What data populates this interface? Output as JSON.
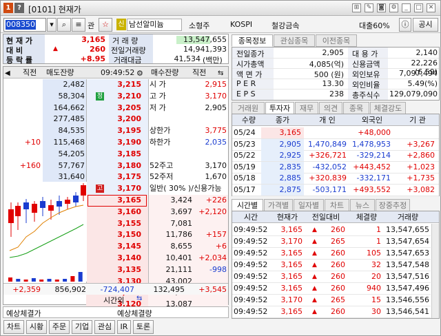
{
  "title": {
    "num1": "1",
    "num2": "?",
    "text": "[0101] 현재가"
  },
  "toolbar": {
    "code": "008350",
    "kwan": "관",
    "sin": "신",
    "name": "남선알미늄",
    "market": "소형주",
    "index": "KOSPI",
    "sector": "철강금속",
    "loan": "대출60%",
    "gong": "공시"
  },
  "summary": {
    "labels": [
      "현 재 가",
      "대  비",
      "등 락 률"
    ],
    "price": "3,165",
    "change": "260",
    "rate": "+8.95",
    "vol_label": "거 래 량",
    "vol": "13,547,655",
    "prev_vol_label": "전일거래량",
    "prev_vol": "14,941,393",
    "amount_label": "거래대금",
    "amount": "41,534",
    "amount_unit": "(백만)"
  },
  "info_tabs": [
    "종목정보",
    "관심종목",
    "이전종목"
  ],
  "info": {
    "rows": [
      {
        "l": "전일종가",
        "v": "2,905",
        "l2": "대 용 가",
        "v2": "2,140"
      },
      {
        "l": "시가총액",
        "v": "4,085(억)",
        "l2": "신용금액",
        "v2": "22,226  (6.59)"
      },
      {
        "l": "액 면 가",
        "v": "500 (원)",
        "l2": "외인보유",
        "v2": "7,097,494"
      },
      {
        "l": "P E R",
        "v": "13.30",
        "l2": "외인비율",
        "v2": "5.49(%)"
      },
      {
        "l": "E P S",
        "v": "238",
        "l2": "총주식수",
        "v2": "129,079,090"
      }
    ]
  },
  "ob_header": {
    "direct": "직전",
    "sell": "매도잔량",
    "time": "09:49:52",
    "buy": "매수잔량",
    "direct2": "직전"
  },
  "asks": [
    {
      "d": "",
      "q": "2,482",
      "p": "3,215",
      "tag": ""
    },
    {
      "d": "",
      "q": "58,304",
      "p": "3,210",
      "tag": "정"
    },
    {
      "d": "",
      "q": "164,662",
      "p": "3,205",
      "tag": ""
    },
    {
      "d": "",
      "q": "277,485",
      "p": "3,200",
      "tag": ""
    },
    {
      "d": "",
      "q": "84,535",
      "p": "3,195",
      "tag": ""
    },
    {
      "d": "+10",
      "q": "115,468",
      "p": "3,190",
      "tag": ""
    },
    {
      "d": "",
      "q": "54,205",
      "p": "3,185",
      "tag": ""
    },
    {
      "d": "+160",
      "q": "57,767",
      "p": "3,180",
      "tag": ""
    },
    {
      "d": "",
      "q": "31,640",
      "p": "3,175",
      "tag": ""
    },
    {
      "d": "+2,189",
      "q": "10,354",
      "p": "3,170",
      "tag": "고"
    }
  ],
  "bids": [
    {
      "p": "3,165",
      "q": "3,424",
      "d": "+226"
    },
    {
      "p": "3,160",
      "q": "3,697",
      "d": "+2,120"
    },
    {
      "p": "3,155",
      "q": "7,081",
      "d": ""
    },
    {
      "p": "3,150",
      "q": "11,786",
      "d": "+157"
    },
    {
      "p": "3,145",
      "q": "8,655",
      "d": "+6"
    },
    {
      "p": "3,140",
      "q": "10,401",
      "d": "+2,034"
    },
    {
      "p": "3,135",
      "q": "21,111",
      "d": "-998"
    },
    {
      "p": "3,130",
      "q": "43,002",
      "d": ""
    },
    {
      "p": "3,125",
      "q": "10,251",
      "d": ""
    },
    {
      "p": "3,120",
      "q": "13,087",
      "d": ""
    }
  ],
  "ask_info": [
    {
      "l": "시  가",
      "v": "2,915"
    },
    {
      "l": "고  가",
      "v": "3,170"
    },
    {
      "l": "저  가",
      "v": "2,905"
    },
    {
      "l": "",
      "v": ""
    },
    {
      "l": "상한가",
      "v": "3,775"
    },
    {
      "l": "하한가",
      "v": "2,035"
    },
    {
      "l": "",
      "v": ""
    },
    {
      "l": "52주고",
      "v": "3,170"
    },
    {
      "l": "52주저",
      "v": "1,670"
    },
    {
      "l": "일반( 30% )/신용가능",
      "v": ""
    }
  ],
  "ob_totals": {
    "d": "+2,359",
    "sell": "856,902",
    "diff": "-724,407",
    "buy": "132,495",
    "d2": "+3,545",
    "after": "시간외"
  },
  "expected": {
    "price_label": "예상체결가",
    "vol_label": "예상체결량"
  },
  "daily_tabs": [
    "거래원",
    "투자자",
    "재무",
    "의견",
    "종목",
    "체결강도"
  ],
  "daily_header": [
    "수량",
    "종가",
    "개  인",
    "외국인",
    "기  관"
  ],
  "daily": [
    {
      "d": "05/24",
      "c": "3,165",
      "i": "",
      "f": "+48,000",
      "g": ""
    },
    {
      "d": "05/23",
      "c": "2,905",
      "i": "1,470,849",
      "f": "1,478,953",
      "g": "+3,267"
    },
    {
      "d": "05/22",
      "c": "2,925",
      "i": "+326,721",
      "f": "-329,214",
      "g": "+2,860"
    },
    {
      "d": "05/19",
      "c": "2,835",
      "i": "-432,052",
      "f": "+443,452",
      "g": "+1,023"
    },
    {
      "d": "05/18",
      "c": "2,885",
      "i": "+320,839",
      "f": "-332,171",
      "g": "+1,735"
    },
    {
      "d": "05/17",
      "c": "2,875",
      "i": "-503,171",
      "f": "+493,552",
      "g": "+3,082"
    }
  ],
  "tick_tabs": [
    "시간별",
    "가격별",
    "일자별",
    "차트",
    "뉴스",
    "장중추정"
  ],
  "tick_header": [
    "시간",
    "현재가",
    "전일대비",
    "체결량",
    "거래량"
  ],
  "ticks": [
    {
      "t": "09:49:52",
      "p": "3,165",
      "c": "260",
      "q": "1",
      "v": "13,547,655"
    },
    {
      "t": "09:49:52",
      "p": "3,170",
      "c": "265",
      "q": "1",
      "v": "13,547,654"
    },
    {
      "t": "09:49:52",
      "p": "3,165",
      "c": "260",
      "q": "105",
      "v": "13,547,653"
    },
    {
      "t": "09:49:52",
      "p": "3,165",
      "c": "260",
      "q": "32",
      "v": "13,547,548"
    },
    {
      "t": "09:49:52",
      "p": "3,165",
      "c": "260",
      "q": "20",
      "v": "13,547,516"
    },
    {
      "t": "09:49:52",
      "p": "3,165",
      "c": "260",
      "q": "940",
      "v": "13,547,496"
    },
    {
      "t": "09:49:52",
      "p": "3,170",
      "c": "265",
      "q": "15",
      "v": "13,546,556"
    },
    {
      "t": "09:49:52",
      "p": "3,165",
      "c": "260",
      "q": "30",
      "v": "13,546,541"
    }
  ],
  "bottom": [
    "차트",
    "시황",
    "주문",
    "기업",
    "관심",
    "IR",
    "토론"
  ]
}
